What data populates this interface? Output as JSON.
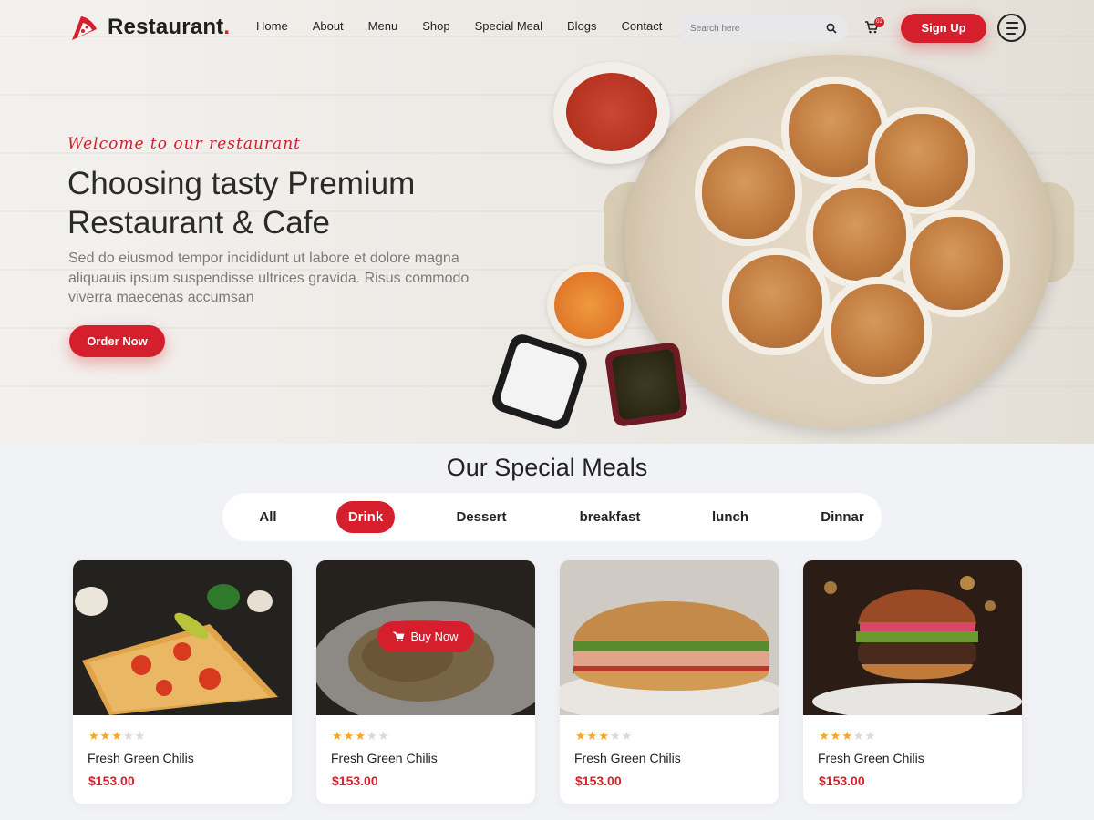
{
  "brand": {
    "name": "Restaurant",
    "dot": ".",
    "accent": "#d61f2c"
  },
  "nav": {
    "items": [
      "Home",
      "About",
      "Menu",
      "Shop",
      "Special Meal",
      "Blogs",
      "Contact"
    ]
  },
  "search": {
    "placeholder": "Search here"
  },
  "cart": {
    "count": "02"
  },
  "header": {
    "signup_label": "Sign Up"
  },
  "hero": {
    "welcome": "Welcome to our restaurant",
    "title": "Choosing tasty Premium Restaurant & Cafe",
    "subtitle": "Sed do eiusmod tempor incididunt ut labore et dolore magna aliquauis ipsum suspendisse ultrices gravida. Risus commodo viverra maecenas accumsan",
    "order_label": "Order Now"
  },
  "special_meals": {
    "title": "Our Special Meals",
    "filters": [
      "All",
      "Drink",
      "Dessert",
      "breakfast",
      "lunch",
      "Dinnar"
    ],
    "active_filter": "Drink",
    "buy_now_label": "Buy Now",
    "cards": [
      {
        "image": "pizza",
        "rating": 3,
        "max_rating": 5,
        "title": "Fresh Green Chilis",
        "price": "$153.00"
      },
      {
        "image": "pasta",
        "rating": 3,
        "max_rating": 5,
        "title": "Fresh Green Chilis",
        "price": "$153.00"
      },
      {
        "image": "sandwich",
        "rating": 3,
        "max_rating": 5,
        "title": "Fresh Green Chilis",
        "price": "$153.00"
      },
      {
        "image": "burger",
        "rating": 3,
        "max_rating": 5,
        "title": "Fresh Green Chilis",
        "price": "$153.00"
      }
    ]
  }
}
